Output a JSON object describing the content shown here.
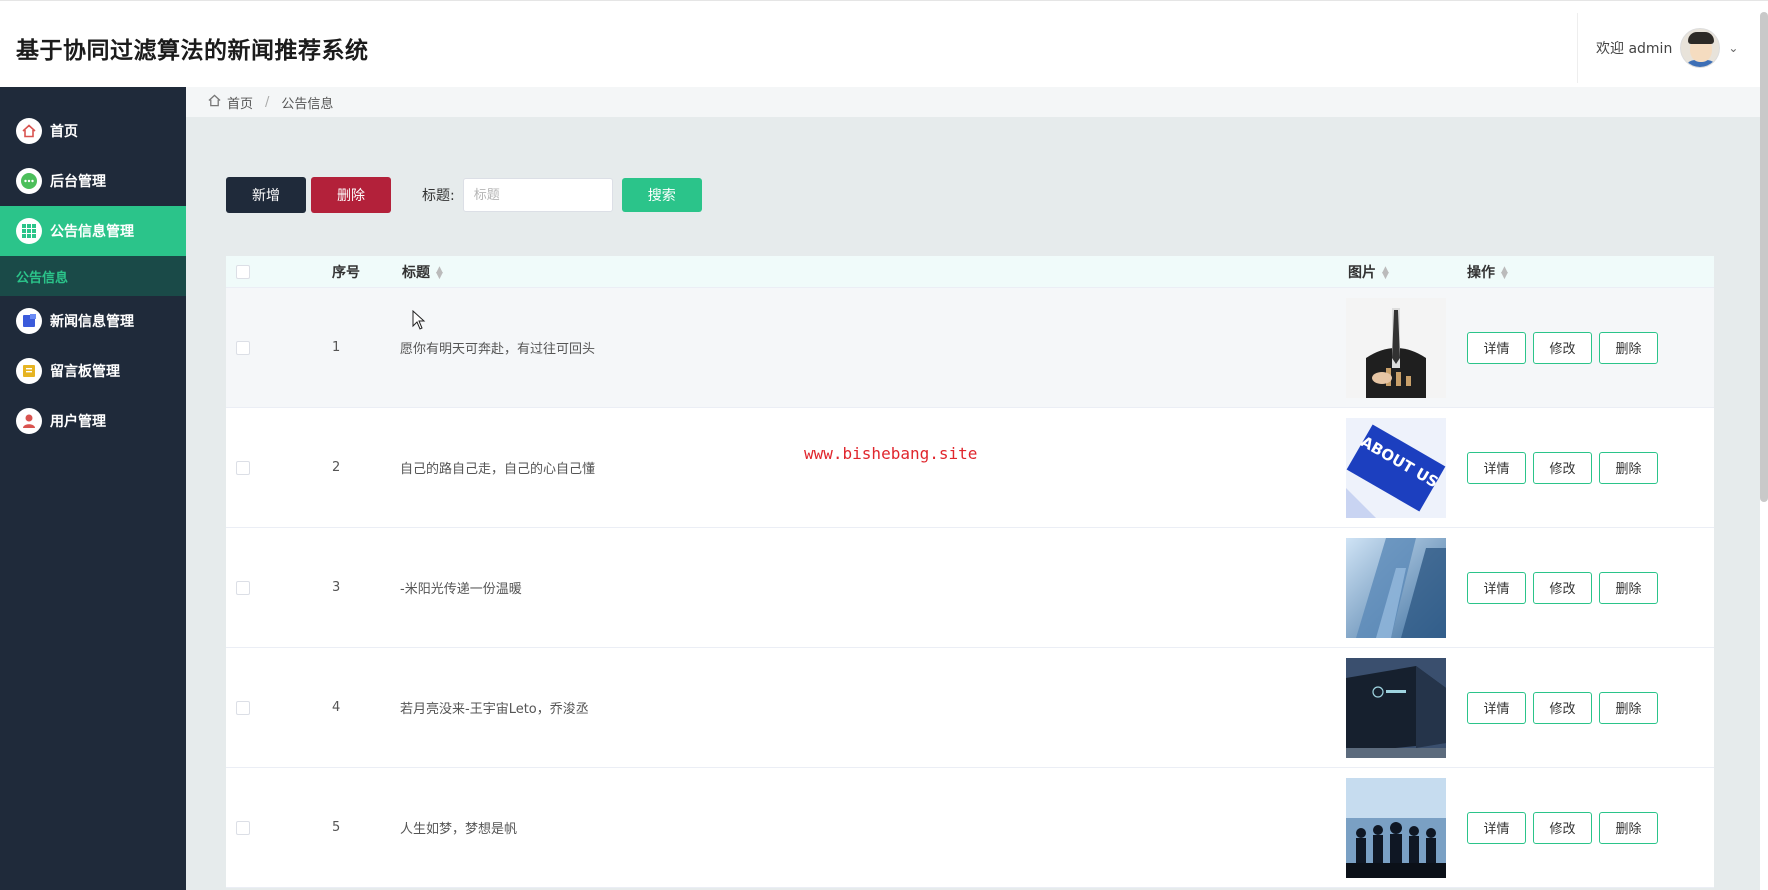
{
  "app": {
    "title": "基于协同过滤算法的新闻推荐系统"
  },
  "header": {
    "welcome": "欢迎 admin"
  },
  "sidebar": {
    "items": [
      {
        "label": "首页"
      },
      {
        "label": "后台管理"
      },
      {
        "label": "公告信息管理"
      },
      {
        "label": "公告信息"
      },
      {
        "label": "新闻信息管理"
      },
      {
        "label": "留言板管理"
      },
      {
        "label": "用户管理"
      }
    ]
  },
  "breadcrumb": {
    "home": "首页",
    "current": "公告信息"
  },
  "toolbar": {
    "add": "新增",
    "delete": "删除",
    "search_label": "标题:",
    "search_placeholder": "标题",
    "search_button": "搜索"
  },
  "table": {
    "columns": {
      "index": "序号",
      "title": "标题",
      "image": "图片",
      "ops": "操作"
    },
    "rows": [
      {
        "index": "1",
        "title": "愿你有明天可奔赴，有过往可回头"
      },
      {
        "index": "2",
        "title": "自己的路自己走，自己的心自己懂"
      },
      {
        "index": "3",
        "title": "-米阳光传递一份温暖"
      },
      {
        "index": "4",
        "title": "若月亮没来-王宇宙Leto，乔浚丞"
      },
      {
        "index": "5",
        "title": "人生如梦，梦想是帆"
      }
    ],
    "op_labels": {
      "detail": "详情",
      "edit": "修改",
      "delete": "删除"
    }
  },
  "watermark": "www.bishebang.site",
  "image_texts": {
    "about_us": "ABOUT US"
  },
  "colors": {
    "sidebar_bg": "#1f2a3a",
    "accent": "#2bc48a",
    "danger": "#b3213a"
  }
}
